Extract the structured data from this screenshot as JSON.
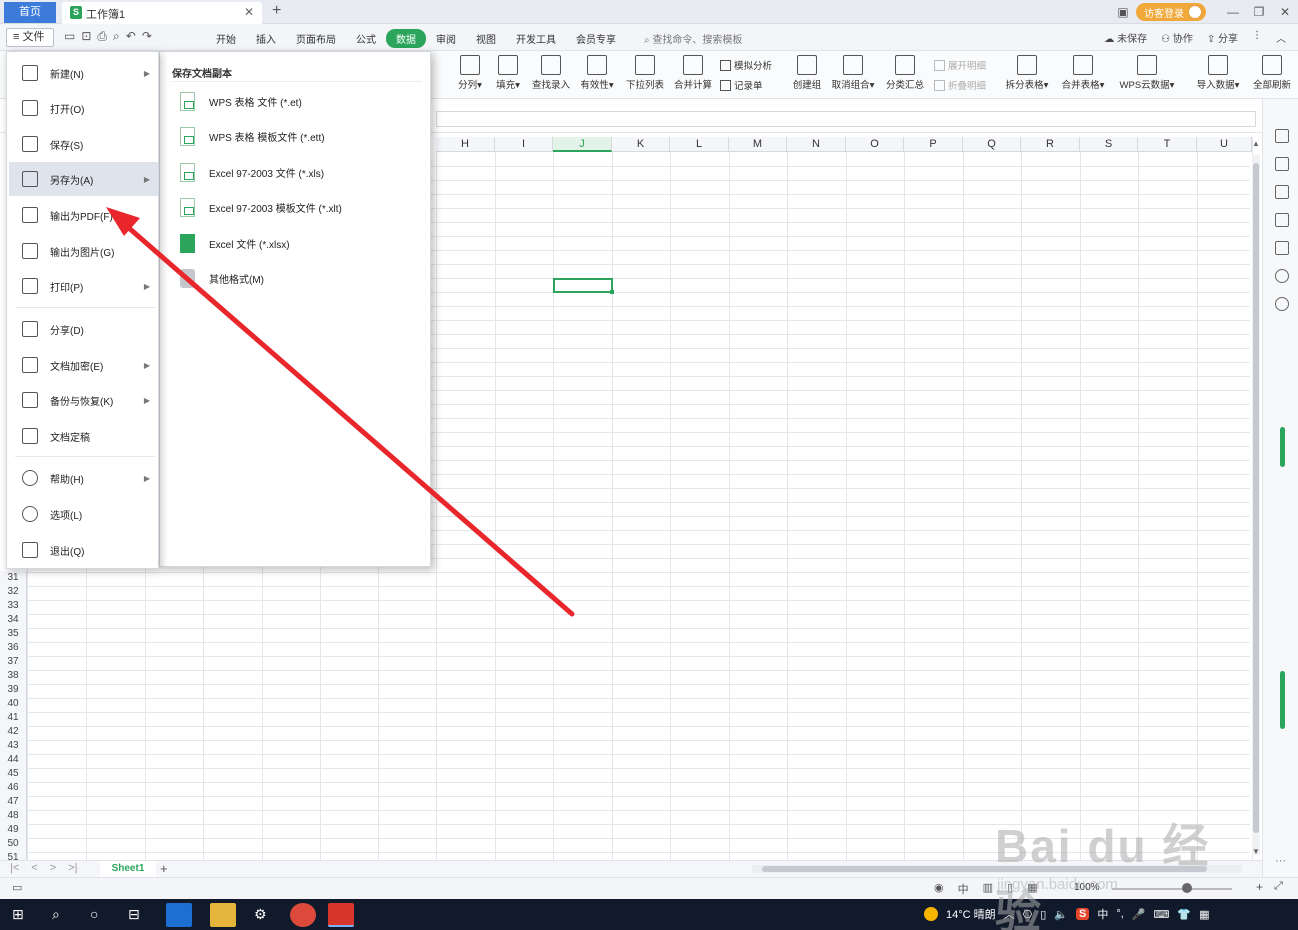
{
  "titlebar": {
    "home_tab": "首页",
    "doc_tab": "工作簿1",
    "doc_icon": "S",
    "login": "访客登录"
  },
  "menubar": {
    "file": "文件",
    "menus": [
      "开始",
      "插入",
      "页面布局",
      "公式",
      "数据",
      "审阅",
      "视图",
      "开发工具",
      "会员专享"
    ],
    "active_menu": "数据",
    "search": "查找命令、搜索模板",
    "unsaved": "未保存",
    "collab": "协作",
    "share": "分享"
  },
  "ribbon": {
    "buttons": [
      "分列",
      "填充",
      "查找录入",
      "有效性",
      "下拉列表",
      "合并计算",
      "创建组",
      "取消组合",
      "分类汇总",
      "拆分表格",
      "合并表格",
      "WPS云数据",
      "导入数据",
      "全部刷新"
    ],
    "small": [
      "模拟分析",
      "记录单",
      "展开明细",
      "折叠明细"
    ]
  },
  "grid": {
    "columns": [
      "H",
      "I",
      "J",
      "K",
      "L",
      "M",
      "N",
      "O",
      "P",
      "Q",
      "R",
      "S",
      "T",
      "U"
    ],
    "selected_column": "J",
    "visible_rows": [
      "31",
      "32",
      "33",
      "34",
      "35",
      "36",
      "37",
      "38",
      "39",
      "40",
      "41",
      "42",
      "43",
      "44",
      "45",
      "46",
      "47",
      "48",
      "49",
      "50",
      "51"
    ]
  },
  "file_menu": {
    "items": [
      {
        "label": "新建(N)",
        "icon": "new-doc-icon",
        "submenu": true
      },
      {
        "label": "打开(O)",
        "icon": "folder-icon",
        "submenu": false
      },
      {
        "label": "保存(S)",
        "icon": "save-icon",
        "submenu": false
      },
      {
        "label": "另存为(A)",
        "icon": "save-as-icon",
        "submenu": true
      },
      {
        "label": "输出为PDF(F)",
        "icon": "pdf-icon",
        "submenu": false
      },
      {
        "label": "输出为图片(G)",
        "icon": "image-icon",
        "submenu": false
      },
      {
        "label": "打印(P)",
        "icon": "print-icon",
        "submenu": true
      },
      {
        "label": "分享(D)",
        "icon": "share-icon",
        "submenu": false
      },
      {
        "label": "文档加密(E)",
        "icon": "lock-doc-icon",
        "submenu": true
      },
      {
        "label": "备份与恢复(K)",
        "icon": "backup-icon",
        "submenu": true
      },
      {
        "label": "文档定稿",
        "icon": "finalize-icon",
        "submenu": false
      },
      {
        "label": "帮助(H)",
        "icon": "help-icon",
        "submenu": true
      },
      {
        "label": "选项(L)",
        "icon": "gear-icon",
        "submenu": false
      },
      {
        "label": "退出(Q)",
        "icon": "exit-icon",
        "submenu": false
      }
    ],
    "hovered": "另存为(A)"
  },
  "save_as_submenu": {
    "title": "保存文档副本",
    "items": [
      "WPS 表格 文件 (*.et)",
      "WPS 表格 模板文件 (*.ett)",
      "Excel 97-2003 文件 (*.xls)",
      "Excel 97-2003 模板文件 (*.xlt)",
      "Excel 文件 (*.xlsx)",
      "其他格式(M)"
    ]
  },
  "sheets": {
    "tabs": [
      "Sheet1"
    ]
  },
  "statusbar": {
    "zoom": "100%"
  },
  "taskbar": {
    "weather": "14°C 晴朗",
    "ime": "中",
    "input_icon": "S"
  },
  "watermark": {
    "text": "Bai du 经验",
    "url": "jingyan.baidu.com"
  },
  "colors": {
    "accent_green": "#2aa55b",
    "home_tab_blue": "#3c7bd9",
    "arrow_red": "#e8262b",
    "taskbar": "#101a2b"
  }
}
